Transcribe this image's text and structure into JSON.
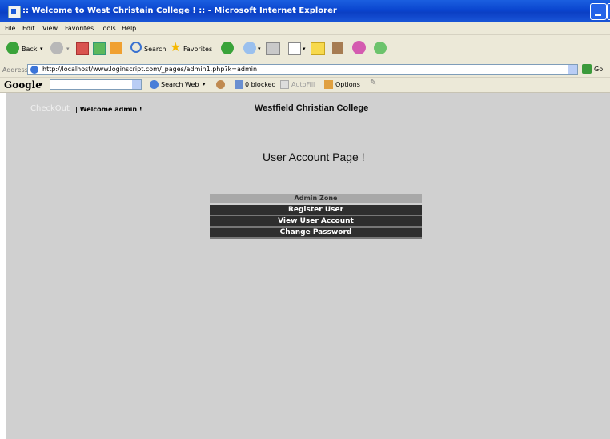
{
  "window": {
    "title": ":: Welcome to West Christain College ! :: - Microsoft Internet Explorer"
  },
  "menu": [
    "File",
    "Edit",
    "View",
    "Favorites",
    "Tools",
    "Help"
  ],
  "toolbar": {
    "back_label": "Back",
    "search_label": "Search",
    "favorites_label": "Favorites"
  },
  "address": {
    "label": "Address",
    "url": "http://localhost/www.loginscript.com/_pages/admin1.php?k=admin",
    "go_label": "Go"
  },
  "googlebar": {
    "logo": "Google",
    "search_web_label": "Search Web",
    "blocked_label": "0 blocked",
    "autofill_label": "AutoFill",
    "options_label": "Options"
  },
  "page": {
    "checkout_link": "CheckOut",
    "welcome": "| Welcome admin !",
    "college_name": "Westfield Christian College",
    "heading": "User Account Page !",
    "admin_zone": {
      "title": "Admin Zone",
      "buttons": [
        "Register User",
        "View User Account",
        "Change Password"
      ]
    }
  },
  "colors": {
    "titlebar": "#0b45cf",
    "page_bg": "#d0d0d0",
    "admin_btn": "#2e2e2e"
  }
}
